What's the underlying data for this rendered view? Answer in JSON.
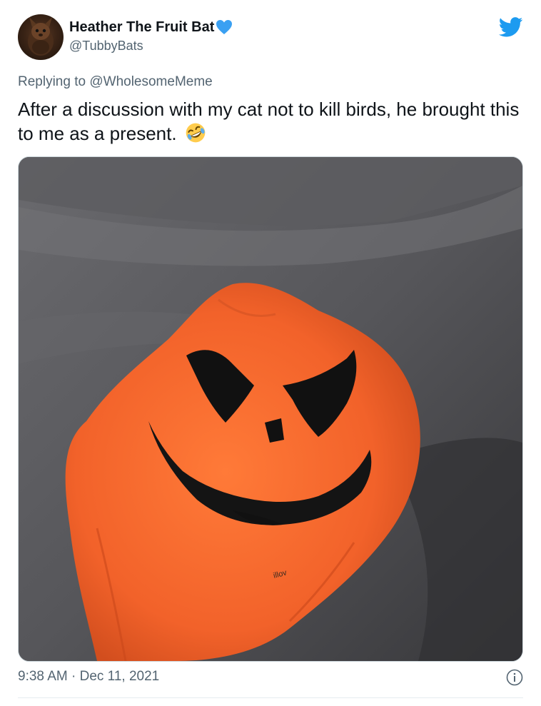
{
  "tweet": {
    "author": {
      "display_name": "Heather The Fruit Bat",
      "handle": "@TubbyBats",
      "verified_icon": "verified-heart-icon",
      "avatar_icon": "bat-avatar"
    },
    "platform_icon": "twitter-bird-icon",
    "replying_prefix": "Replying to",
    "replying_to": "@WholesomeMeme",
    "text": "After a discussion with my cat not to kill birds, he brought this to me as a present.",
    "text_emoji": "rolling-on-floor-laughing-emoji",
    "media": {
      "kind": "photo",
      "subject": "orange jack-o-lantern plastic bag on grey blanket"
    },
    "timestamp": "9:38 AM · Dec 11, 2021",
    "info_icon": "info-icon"
  },
  "colors": {
    "text_primary": "#0f1419",
    "text_secondary": "#536471",
    "twitter_blue": "#1d9bf0",
    "pumpkin_orange": "#f26a2e"
  }
}
